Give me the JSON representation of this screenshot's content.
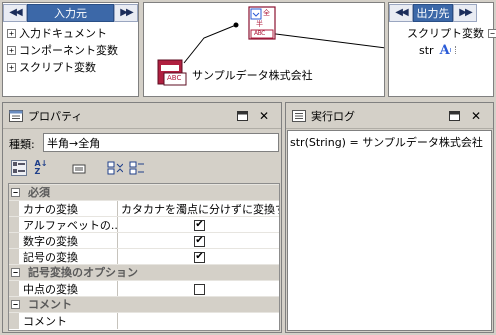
{
  "input_pane": {
    "title": "入力元",
    "tree": [
      "入力ドキュメント",
      "コンポーネント変数",
      "スクリプト変数"
    ]
  },
  "canvas": {
    "node_label": "サンプルデータ株式会社",
    "conv_icon_chars": {
      "top": "全",
      "mid": "半",
      "bottom": "ABC"
    },
    "src_icon_chars": "ABC"
  },
  "output_pane": {
    "title": "出力先",
    "tree_root": "スクリプト変数",
    "var_name": "str"
  },
  "properties": {
    "title": "プロパティ",
    "type_label": "種類:",
    "type_value": "半角→全角",
    "categories": [
      {
        "name": "必須",
        "rows": [
          {
            "name": "カナの変換",
            "value": "カタカナを濁点に分けずに変換する"
          },
          {
            "name": "アルファベットの...",
            "checked": true
          },
          {
            "name": "数字の変換",
            "checked": true
          },
          {
            "name": "記号の変換",
            "checked": true
          }
        ]
      },
      {
        "name": "記号変換のオプション",
        "rows": [
          {
            "name": "中点の変換",
            "checked": false
          }
        ]
      },
      {
        "name": "コメント",
        "rows": [
          {
            "name": "コメント",
            "value": ""
          }
        ]
      }
    ]
  },
  "log": {
    "title": "実行ログ",
    "entry": "str(String) = サンプルデータ株式会社"
  },
  "colors": {
    "header_blue": "#3c68a8",
    "panel_gray": "#d4d0c8",
    "accent_red": "#b02040",
    "link_blue": "#2a5bd7"
  }
}
